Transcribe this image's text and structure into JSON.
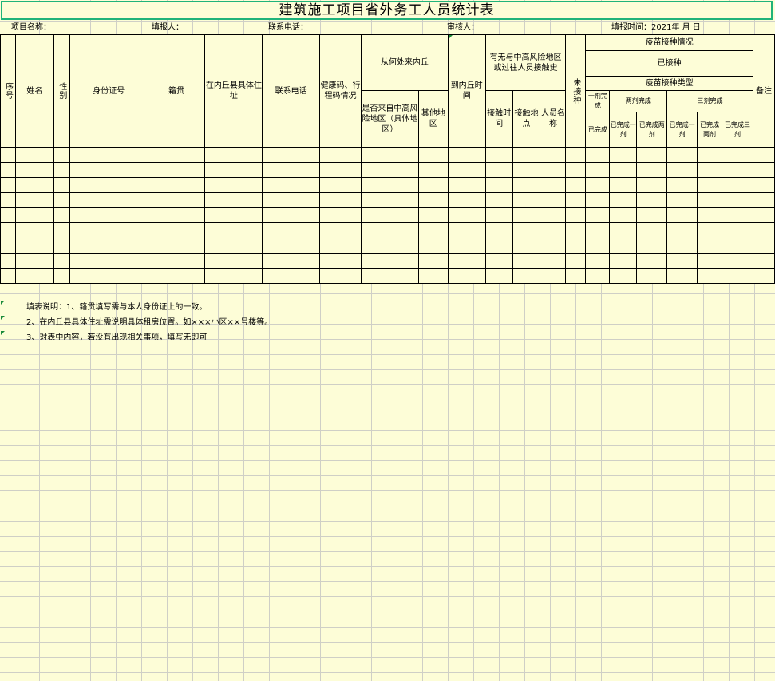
{
  "title": "建筑施工项目省外务工人员统计表",
  "info": {
    "project_name": "项目名称：",
    "filler": "填报人：",
    "contact_phone": "联系电话：",
    "reviewer": "审核人：",
    "fill_date": "填报时间：2021年    月     日"
  },
  "headers": {
    "seq": "序号",
    "name": "姓名",
    "gender": "性别",
    "id_number": "身份证号",
    "native_place": "籍贯",
    "address": "在内丘县具体住址",
    "phone": "联系电话",
    "health_code": "健康码、行程码情况",
    "origin": "从何处来内丘",
    "origin_high_risk": "是否来自中高风险地区（具体地区）",
    "origin_other": "其他地区",
    "arrival_time": "到内丘时间",
    "risk_contact": "有无与中高风险地区或过往人员接触史",
    "contact_time": "接触时间",
    "contact_place": "接触地点",
    "contact_person": "人员名称",
    "unvaccinated": "未接种",
    "vaccine_status": "疫苗接种情况",
    "vaccinated": "已接种",
    "vaccine_type": "疫苗接种类型",
    "one_dose": "一剂完成",
    "two_dose": "两剂完成",
    "three_dose": "三剂完成",
    "done": "已完成",
    "done_one": "已完成一剂",
    "done_two": "已完成两剂",
    "done_one_b": "已完成一剂",
    "done_two_b": "已完成两剂",
    "done_three": "已完成三剂",
    "remarks": "备注"
  },
  "notes": [
    "填表说明：1、籍贯填写需与本人身份证上的一致。",
    "2、在内丘县具体住址需说明具体租房位置。如×××小区××号楼等。",
    "3、对表中内容，若没有出现相关事项，填写无即可"
  ],
  "colors": {
    "background": "#fdfdd7",
    "title_border": "#1fb37a"
  }
}
